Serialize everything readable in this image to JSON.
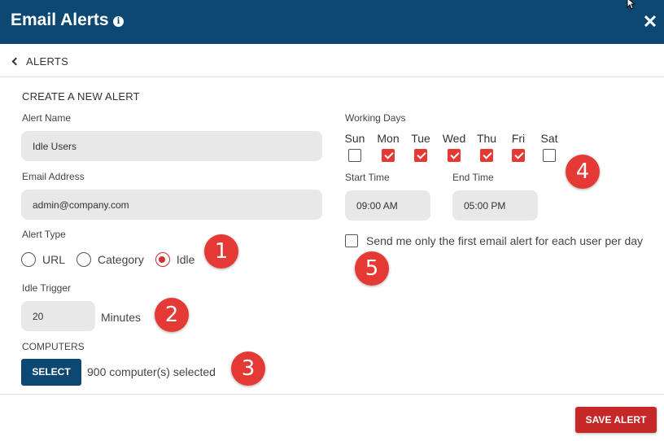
{
  "header": {
    "title": "Email Alerts",
    "info_icon": "info-icon",
    "close_icon": "close-icon"
  },
  "nav": {
    "back_label": "ALERTS"
  },
  "form": {
    "section_title": "CREATE A NEW ALERT",
    "alert_name": {
      "label": "Alert Name",
      "value": "Idle Users"
    },
    "email": {
      "label": "Email Address",
      "value": "admin@company.com"
    },
    "alert_type": {
      "label": "Alert Type",
      "options": [
        {
          "label": "URL",
          "checked": false
        },
        {
          "label": "Category",
          "checked": false
        },
        {
          "label": "Idle",
          "checked": true
        }
      ]
    },
    "idle_trigger": {
      "label": "Idle Trigger",
      "value": "20",
      "unit": "Minutes"
    },
    "computers": {
      "label": "COMPUTERS",
      "select_label": "SELECT",
      "selected_text": "900 computer(s) selected"
    },
    "working_days": {
      "label": "Working Days",
      "days": [
        {
          "label": "Sun",
          "checked": false
        },
        {
          "label": "Mon",
          "checked": true
        },
        {
          "label": "Tue",
          "checked": true
        },
        {
          "label": "Wed",
          "checked": true
        },
        {
          "label": "Thu",
          "checked": true
        },
        {
          "label": "Fri",
          "checked": true
        },
        {
          "label": "Sat",
          "checked": false
        }
      ]
    },
    "start_time": {
      "label": "Start Time",
      "value": "09:00 AM"
    },
    "end_time": {
      "label": "End Time",
      "value": "05:00 PM"
    },
    "first_alert": {
      "label": "Send me only the first email alert for each user per day",
      "checked": false
    }
  },
  "badges": [
    "1",
    "2",
    "3",
    "4",
    "5"
  ],
  "footer": {
    "save_label": "SAVE ALERT"
  },
  "colors": {
    "header": "#0c4872",
    "accent": "#e53935",
    "save": "#c62828"
  }
}
